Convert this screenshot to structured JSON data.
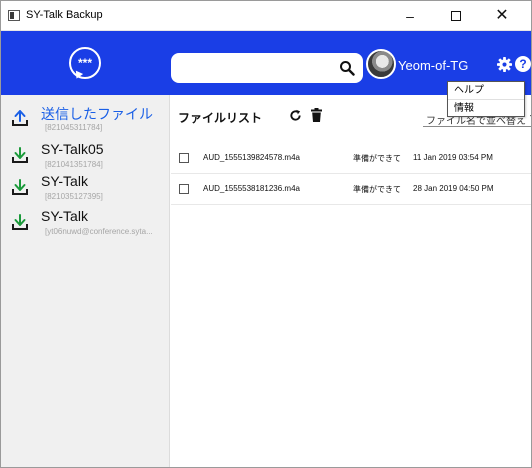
{
  "window": {
    "title": "SY-Talk Backup",
    "minimize_glyph": "–",
    "close_glyph": "✕"
  },
  "header": {
    "logo_dots": "***",
    "search": {
      "value": "",
      "placeholder": ""
    },
    "user_name": "Yeom-of-TG",
    "help_glyph": "?",
    "brand_color": "#1a3ee6"
  },
  "menu": {
    "items": [
      {
        "label": "ヘルプ"
      },
      {
        "label": "情報"
      }
    ]
  },
  "sidebar": {
    "items": [
      {
        "name": "送信したファイル",
        "id": "[821045311784]",
        "icon": "upload-icon",
        "active": true
      },
      {
        "name": "SY-Talk05",
        "id": "[821041351784]",
        "icon": "download-icon",
        "active": false
      },
      {
        "name": "SY-Talk",
        "id": "[821035127395]",
        "icon": "download-icon",
        "active": false
      },
      {
        "name": "SY-Talk",
        "id": "[yt06nuwd@conference.syta...",
        "icon": "download-icon",
        "active": false
      }
    ]
  },
  "main": {
    "title": "ファイルリスト",
    "sort_label": "ファイル名で並べ替え",
    "files": [
      {
        "name": "AUD_1555139824578.m4a",
        "status": "準備ができて",
        "date": "11 Jan 2019 03:54 PM"
      },
      {
        "name": "AUD_1555538181236.m4a",
        "status": "準備ができて",
        "date": "28 Jan 2019 04:50 PM"
      }
    ]
  }
}
